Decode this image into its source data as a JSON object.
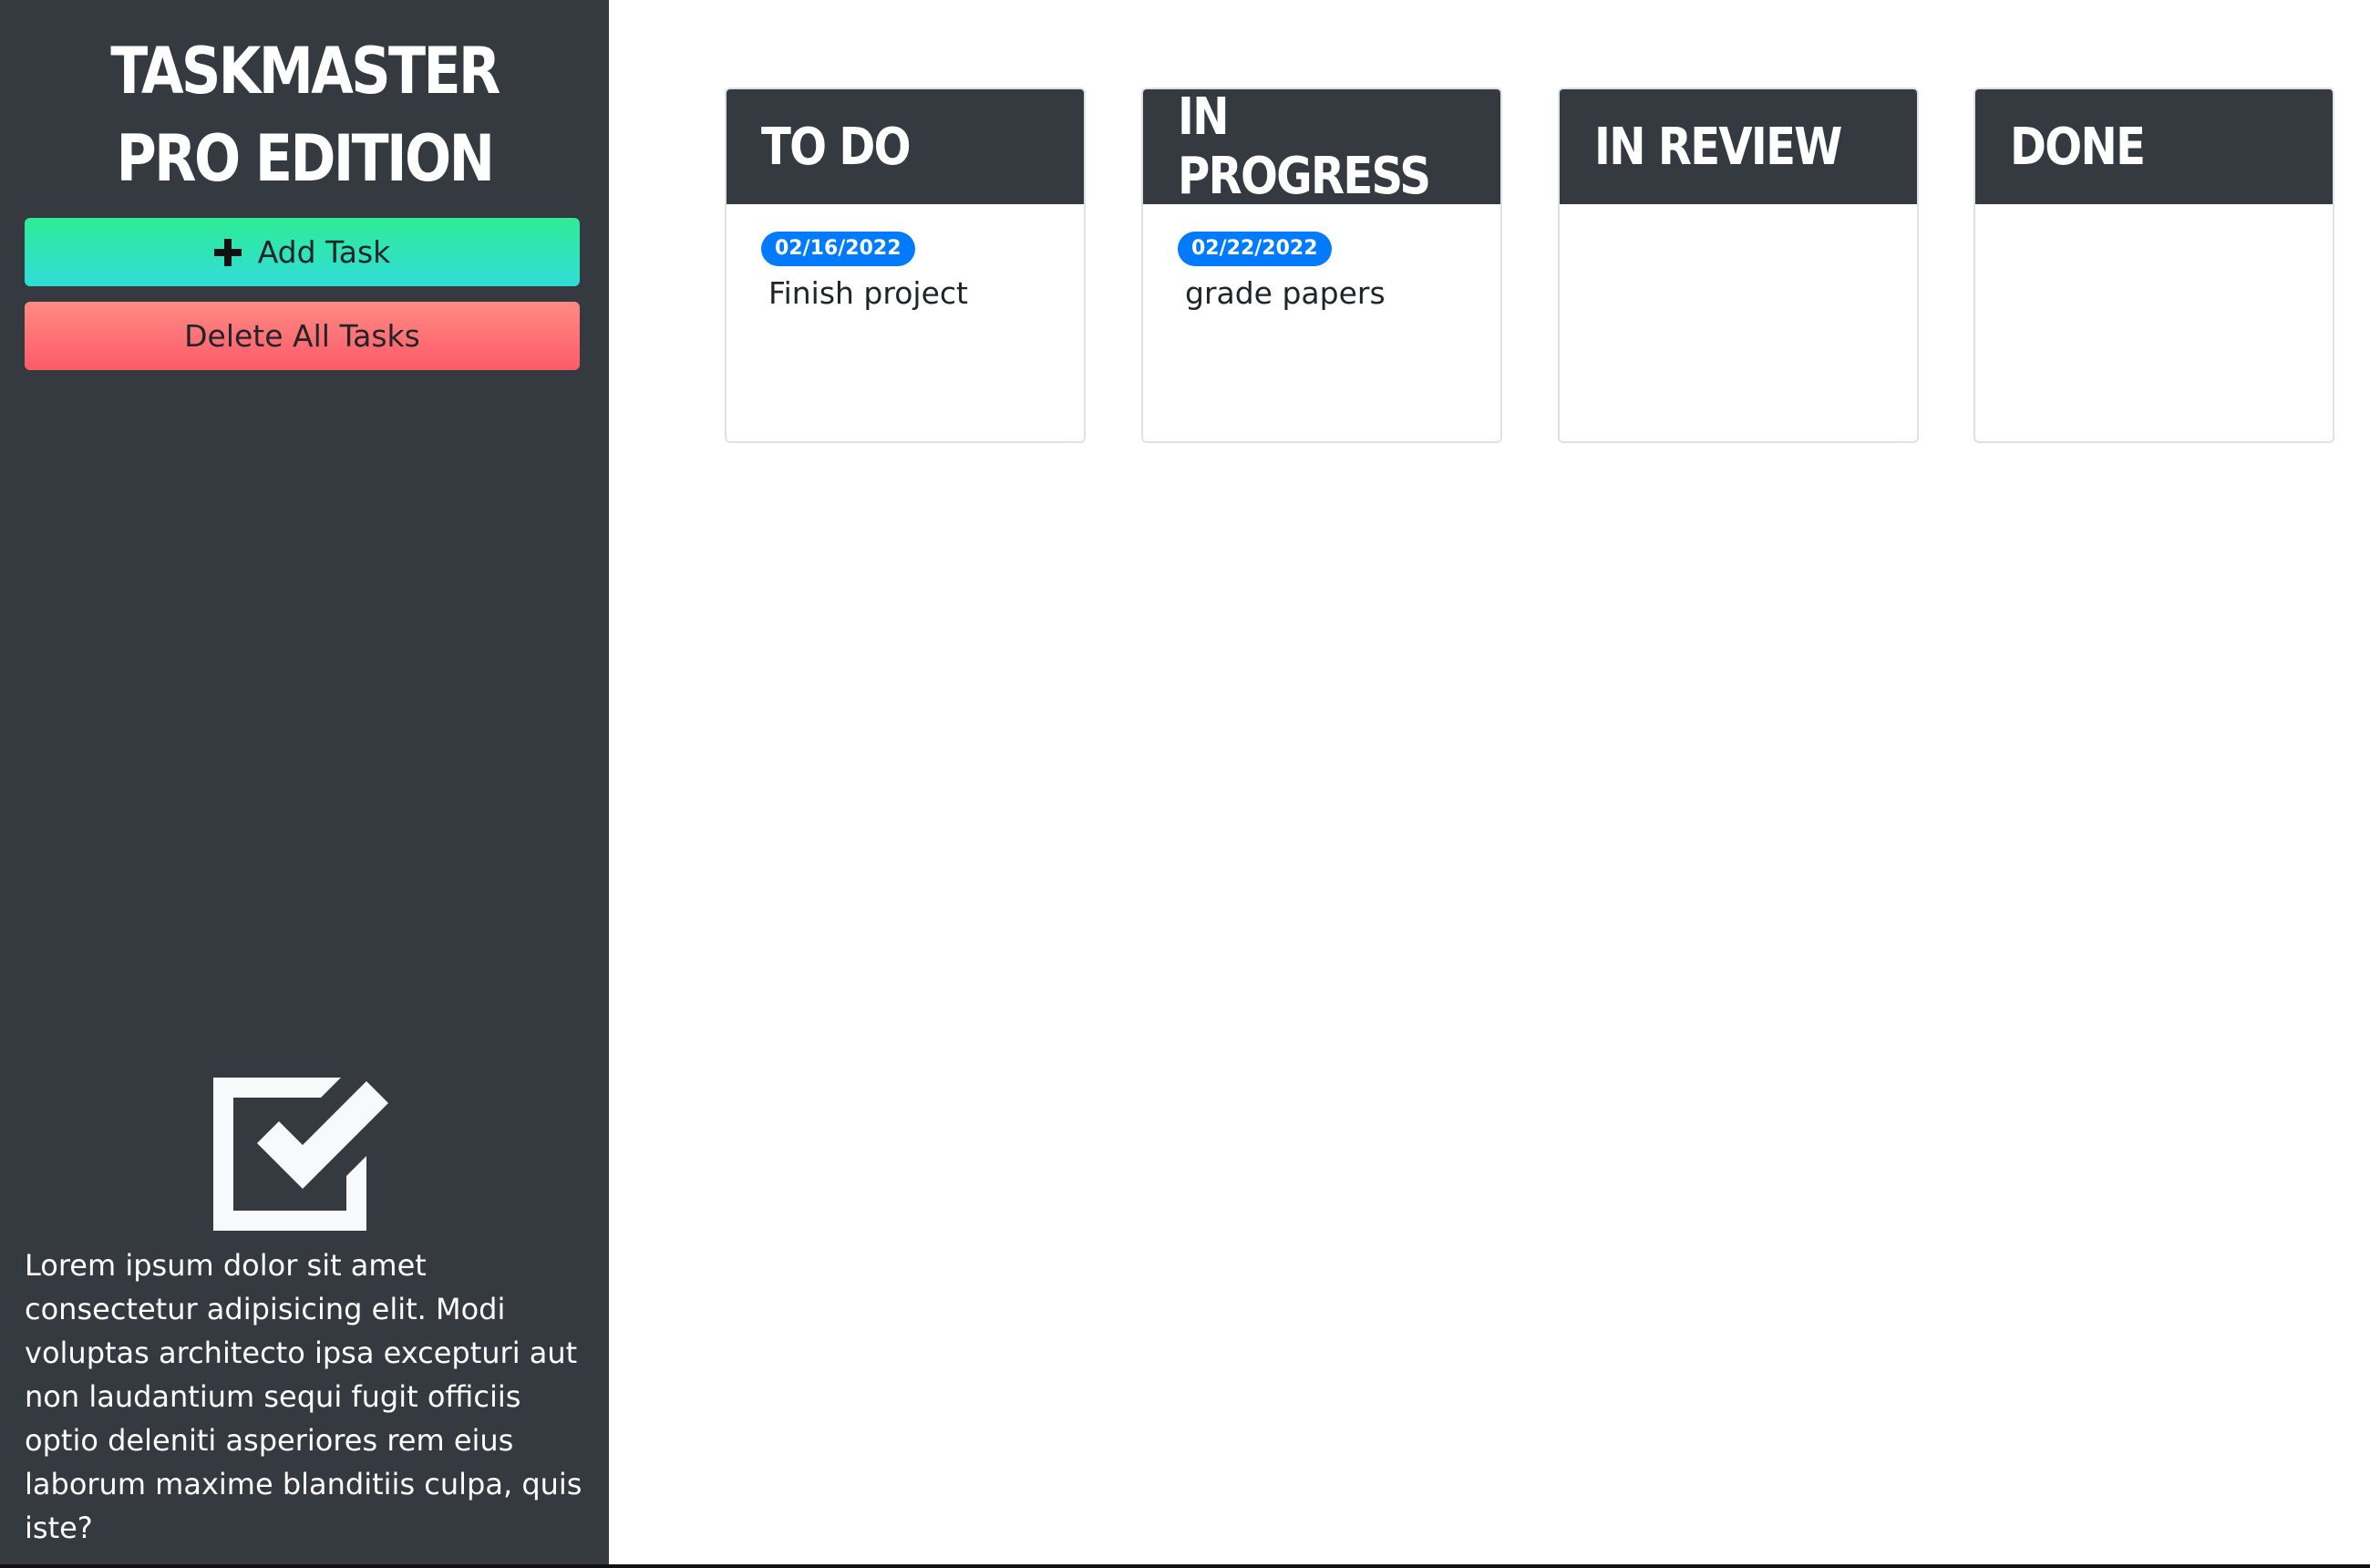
{
  "sidebar": {
    "title": "TASKMASTER PRO EDITION",
    "add_task_label": "Add Task",
    "delete_all_label": "Delete All Tasks",
    "description": "Lorem ipsum dolor sit amet consectetur adipisicing elit. Modi voluptas architecto ipsa excepturi aut non laudantium sequi fugit officiis optio deleniti asperiores rem eius laborum maxime blanditiis culpa, quis iste?",
    "icons": {
      "add": "plus-icon",
      "logo": "checkbox-check-icon"
    }
  },
  "board": {
    "columns": [
      {
        "title": "TO DO",
        "tasks": [
          {
            "date": "02/16/2022",
            "text": "Finish project"
          }
        ]
      },
      {
        "title": "IN PROGRESS",
        "tasks": [
          {
            "date": "02/22/2022",
            "text": "grade papers"
          }
        ]
      },
      {
        "title": "IN REVIEW",
        "tasks": []
      },
      {
        "title": "DONE",
        "tasks": []
      }
    ]
  },
  "colors": {
    "sidebar_bg": "#343a40",
    "add_button_gradient": [
      "#2fec96",
      "#30dcd8"
    ],
    "delete_button_gradient": [
      "#ff8a84",
      "#fc5b68"
    ],
    "badge": "#007bff"
  }
}
